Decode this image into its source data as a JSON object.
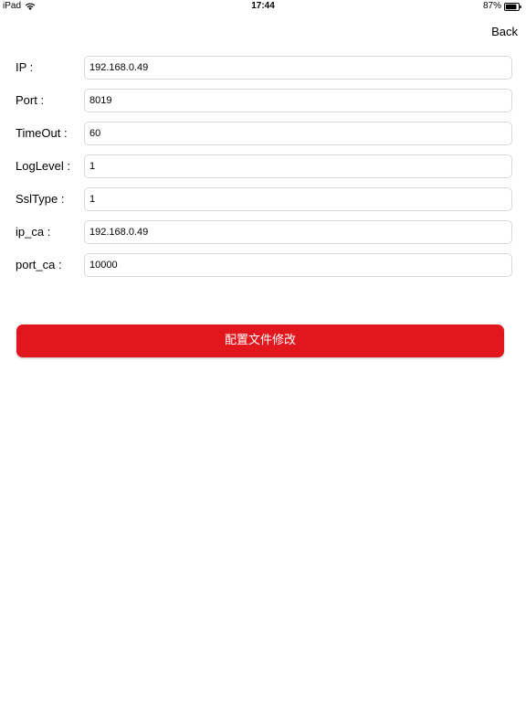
{
  "status_bar": {
    "device": "iPad",
    "time": "17:44",
    "battery": "87%",
    "battery_level": 0.87
  },
  "nav": {
    "back_label": "Back"
  },
  "form": {
    "fields": [
      {
        "label": "IP :",
        "value": "192.168.0.49"
      },
      {
        "label": "Port :",
        "value": "8019"
      },
      {
        "label": "TimeOut :",
        "value": "60"
      },
      {
        "label": "LogLevel :",
        "value": "1"
      },
      {
        "label": "SslType :",
        "value": "1"
      },
      {
        "label": "ip_ca :",
        "value": "192.168.0.49"
      },
      {
        "label": "port_ca :",
        "value": "10000"
      }
    ]
  },
  "action": {
    "label": "配置文件修改",
    "color": "#e2171d"
  }
}
